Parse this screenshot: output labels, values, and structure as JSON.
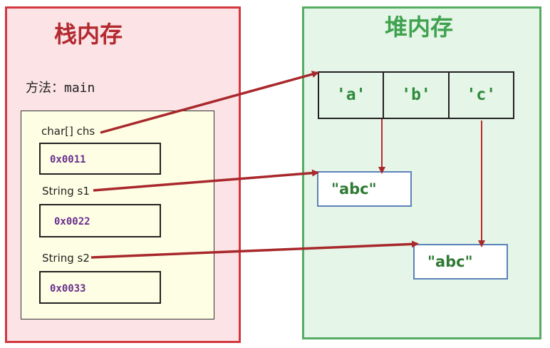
{
  "stack": {
    "title": "栈内存",
    "method_label": "方法：main"
  },
  "heap": {
    "title": "堆内存"
  },
  "variables": [
    {
      "label": "char[]  chs",
      "address": "0x0011"
    },
    {
      "label": "String  s1",
      "address": "0x0022"
    },
    {
      "label": "String  s2",
      "address": "0x0033"
    }
  ],
  "char_array": [
    "'a'",
    "'b'",
    "'c'"
  ],
  "strings": [
    {
      "text": "\"abc\""
    },
    {
      "text": "\"abc\""
    }
  ],
  "colors": {
    "stack_border": "#d3373f",
    "stack_fill": "#fbe3e6",
    "heap_border": "#55ad63",
    "heap_fill": "#e5f5e7",
    "frame_fill": "#fefee4",
    "address_text": "#6a2f8f",
    "value_text": "#2f8a3c",
    "string_border": "#5b82b8",
    "arrow": "#a8282c"
  }
}
